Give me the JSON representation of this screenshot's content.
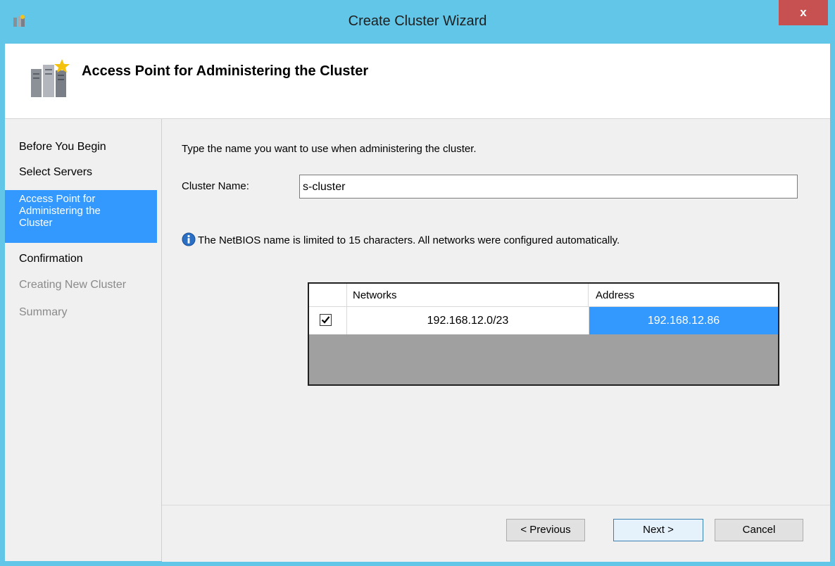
{
  "window": {
    "title": "Create Cluster Wizard",
    "close_label": "x"
  },
  "header": {
    "title": "Access Point for Administering the Cluster"
  },
  "nav": {
    "items": [
      {
        "label": "Before You Begin",
        "state": "normal"
      },
      {
        "label": "Select Servers",
        "state": "normal"
      },
      {
        "label": "Access Point for Administering the Cluster",
        "label_lines": [
          "Access Point for",
          "Administering the",
          "Cluster"
        ],
        "state": "active"
      },
      {
        "label": "Confirmation",
        "state": "normal"
      },
      {
        "label": "Creating New Cluster",
        "state": "disabled"
      },
      {
        "label": "Summary",
        "state": "disabled"
      }
    ]
  },
  "content": {
    "instruction": "Type the name you want to use when administering the cluster.",
    "cluster_name_label": "Cluster Name:",
    "cluster_name_value": "s-cluster",
    "info_text": "The NetBIOS name is limited to 15 characters.  All networks were configured automatically.",
    "grid": {
      "columns": [
        "Networks",
        "Address"
      ],
      "rows": [
        {
          "checked": true,
          "network": "192.168.12.0/23",
          "address": "192.168.12.86"
        }
      ]
    }
  },
  "buttons": {
    "previous": "< Previous",
    "next": "Next >",
    "cancel": "Cancel"
  },
  "colors": {
    "titlebar": "#62c6e8",
    "selection": "#3399ff",
    "close": "#c75050"
  }
}
